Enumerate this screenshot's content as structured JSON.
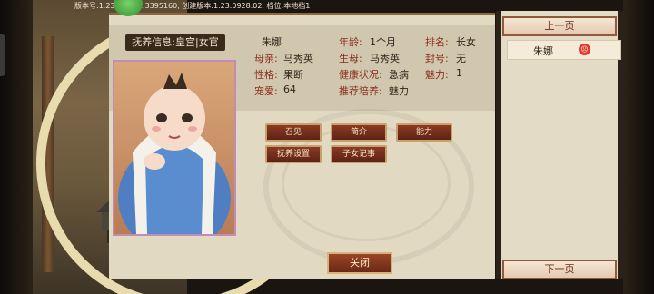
{
  "version_line": "版本号:1.23.0927.1.3395160,  创建版本:1.23.0928.02, 档位:本地档1",
  "info_title": "抚养信息:皇宫|女官",
  "child": {
    "name": "朱娜",
    "age_label": "年龄:",
    "age": "1个月",
    "rank_label": "排名:",
    "rank": "长女",
    "mother_label": "母亲:",
    "mother": "马秀英",
    "birth_mother_label": "生母:",
    "birth_mother": "马秀英",
    "title_label": "封号:",
    "title": "无",
    "personality_label": "性格:",
    "personality": "果断",
    "health_label": "健康状况:",
    "health": "急病",
    "charm_label": "魅力:",
    "charm": "1",
    "favor_label": "宠爱:",
    "favor": "64",
    "training_label": "推荐培养:",
    "training": "魅力"
  },
  "buttons": {
    "summon": "召见",
    "intro": "简介",
    "ability": "能力",
    "raise_settings": "抚养设置",
    "records": "子女记事",
    "close": "关闭"
  },
  "right_list": {
    "prev_page": "上一页",
    "next_page": "下一页",
    "items": [
      {
        "name": "朱娜",
        "status_color": "#e8352a"
      }
    ]
  },
  "colors": {
    "label": "#8a2e1e",
    "button_bg": "#7a3220",
    "panel_bg": "#e2d9c3"
  }
}
